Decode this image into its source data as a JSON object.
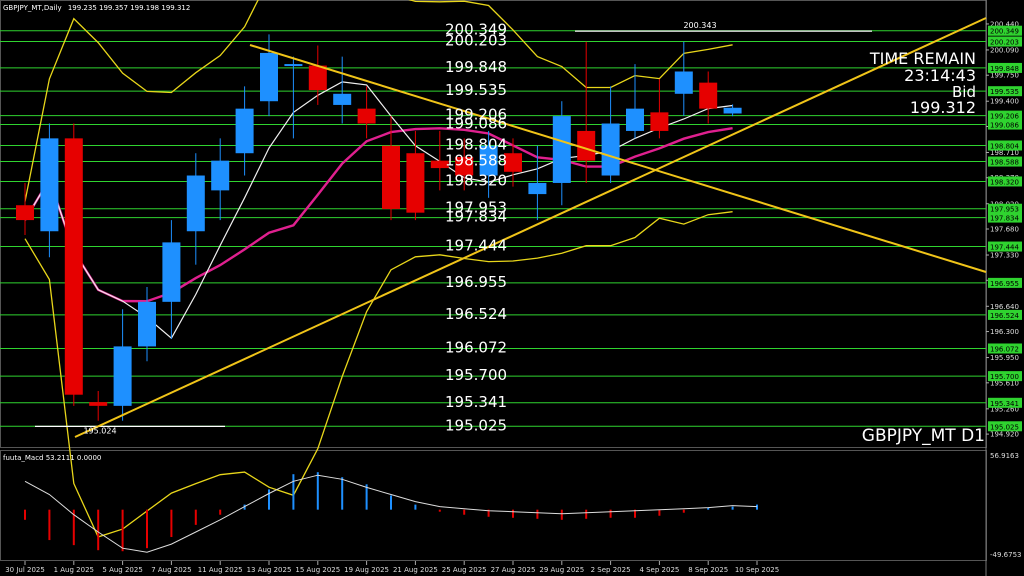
{
  "window": {
    "symbol_title": "GBPJPY_MT,Daily",
    "ohlc_header": "199.235 199.357 199.198 199.312",
    "corner_label": "GBPJPY_MT D1"
  },
  "info": {
    "time_remain_label": "TIME REMAIN",
    "time_remain_value": "23:14:43",
    "bid_label": "Bid",
    "bid_value": "199.312"
  },
  "levels": [
    {
      "price": 200.349,
      "label": "200.349",
      "axis_label": "200.349"
    },
    {
      "price": 200.203,
      "label": "200.203",
      "axis_label": "200.203"
    },
    {
      "price": 199.848,
      "label": "199.848",
      "axis_label": "199.848"
    },
    {
      "price": 199.535,
      "label": "199.535",
      "axis_label": "199.535"
    },
    {
      "price": 199.206,
      "label": "199.206",
      "axis_label": "199.206"
    },
    {
      "price": 199.086,
      "label": "199.086",
      "axis_label": "199.086"
    },
    {
      "price": 198.804,
      "label": "198.804",
      "axis_label": "198.804"
    },
    {
      "price": 198.588,
      "label": "198.588",
      "axis_label": "198.588"
    },
    {
      "price": 198.32,
      "label": "198.320",
      "axis_label": "198.320"
    },
    {
      "price": 197.953,
      "label": "197.953",
      "axis_label": "197.953"
    },
    {
      "price": 197.834,
      "label": "197.834",
      "axis_label": "197.834"
    },
    {
      "price": 197.444,
      "label": "197.444",
      "axis_label": "197.444"
    },
    {
      "price": 196.955,
      "label": "196.955",
      "axis_label": "196.955"
    },
    {
      "price": 196.524,
      "label": "196.524",
      "axis_label": "196.524"
    },
    {
      "price": 196.072,
      "label": "196.072",
      "axis_label": "196.072"
    },
    {
      "price": 195.7,
      "label": "195.700",
      "axis_label": "195.700"
    },
    {
      "price": 195.341,
      "label": "195.341",
      "axis_label": "195.341"
    },
    {
      "price": 195.025,
      "label": "195.025",
      "axis_label": "195.025"
    }
  ],
  "marks": {
    "high_line": {
      "price": 200.343,
      "label": "200.343"
    },
    "low_line": {
      "price": 195.024,
      "label": "195.024"
    }
  },
  "chart_data": {
    "type": "candlestick",
    "symbol": "GBPJPY_MT",
    "timeframe": "D1",
    "price_axis_ticks": [
      200.44,
      200.09,
      199.75,
      199.4,
      199.06,
      198.71,
      198.37,
      198.02,
      197.68,
      197.33,
      196.99,
      196.64,
      196.3,
      195.95,
      195.61,
      195.26,
      194.92
    ],
    "price_range": [
      194.8,
      200.52
    ],
    "date_labels": [
      {
        "bar": 0,
        "text": "30 Jul 2025"
      },
      {
        "bar": 2,
        "text": "1 Aug 2025"
      },
      {
        "bar": 4,
        "text": "5 Aug 2025"
      },
      {
        "bar": 6,
        "text": "7 Aug 2025"
      },
      {
        "bar": 8,
        "text": "11 Aug 2025"
      },
      {
        "bar": 10,
        "text": "13 Aug 2025"
      },
      {
        "bar": 12,
        "text": "15 Aug 2025"
      },
      {
        "bar": 14,
        "text": "19 Aug 2025"
      },
      {
        "bar": 16,
        "text": "21 Aug 2025"
      },
      {
        "bar": 18,
        "text": "25 Aug 2025"
      },
      {
        "bar": 20,
        "text": "27 Aug 2025"
      },
      {
        "bar": 22,
        "text": "29 Aug 2025"
      },
      {
        "bar": 24,
        "text": "2 Sep 2025"
      },
      {
        "bar": 26,
        "text": "4 Sep 2025"
      },
      {
        "bar": 28,
        "text": "8 Sep 2025"
      },
      {
        "bar": 30,
        "text": "10 Sep 2025"
      }
    ],
    "candles": [
      {
        "o": 198.0,
        "h": 198.3,
        "l": 197.6,
        "c": 197.8
      },
      {
        "o": 197.65,
        "h": 199.1,
        "l": 197.3,
        "c": 198.9
      },
      {
        "o": 198.9,
        "h": 199.1,
        "l": 195.3,
        "c": 195.45
      },
      {
        "o": 195.35,
        "h": 195.5,
        "l": 195.1,
        "c": 195.3
      },
      {
        "o": 195.3,
        "h": 196.6,
        "l": 195.1,
        "c": 196.1
      },
      {
        "o": 196.1,
        "h": 196.9,
        "l": 195.9,
        "c": 196.7
      },
      {
        "o": 196.7,
        "h": 197.8,
        "l": 196.2,
        "c": 197.5
      },
      {
        "o": 197.65,
        "h": 198.7,
        "l": 197.2,
        "c": 198.4
      },
      {
        "o": 198.2,
        "h": 198.9,
        "l": 197.8,
        "c": 198.6
      },
      {
        "o": 198.7,
        "h": 199.6,
        "l": 198.4,
        "c": 199.3
      },
      {
        "o": 199.4,
        "h": 200.3,
        "l": 199.2,
        "c": 200.05
      },
      {
        "o": 199.9,
        "h": 200.0,
        "l": 198.9,
        "c": 199.9
      },
      {
        "o": 199.88,
        "h": 200.15,
        "l": 199.35,
        "c": 199.55
      },
      {
        "o": 199.35,
        "h": 200.0,
        "l": 199.1,
        "c": 199.5
      },
      {
        "o": 199.3,
        "h": 199.6,
        "l": 198.9,
        "c": 199.1
      },
      {
        "o": 198.8,
        "h": 199.2,
        "l": 197.8,
        "c": 197.95
      },
      {
        "o": 198.7,
        "h": 199.0,
        "l": 197.8,
        "c": 197.9
      },
      {
        "o": 198.6,
        "h": 199.0,
        "l": 198.2,
        "c": 198.5
      },
      {
        "o": 198.65,
        "h": 198.9,
        "l": 198.2,
        "c": 198.4
      },
      {
        "o": 198.4,
        "h": 199.0,
        "l": 198.1,
        "c": 198.8
      },
      {
        "o": 198.7,
        "h": 198.9,
        "l": 198.25,
        "c": 198.45
      },
      {
        "o": 198.15,
        "h": 198.8,
        "l": 197.8,
        "c": 198.3
      },
      {
        "o": 198.3,
        "h": 199.4,
        "l": 198.0,
        "c": 199.2
      },
      {
        "o": 199.0,
        "h": 200.2,
        "l": 198.3,
        "c": 198.6
      },
      {
        "o": 198.4,
        "h": 199.6,
        "l": 198.3,
        "c": 199.1
      },
      {
        "o": 199.0,
        "h": 199.9,
        "l": 198.9,
        "c": 199.3
      },
      {
        "o": 199.25,
        "h": 199.7,
        "l": 198.9,
        "c": 199.0
      },
      {
        "o": 199.5,
        "h": 200.2,
        "l": 199.2,
        "c": 199.8
      },
      {
        "o": 199.65,
        "h": 199.8,
        "l": 199.1,
        "c": 199.3
      },
      {
        "o": 199.235,
        "h": 199.357,
        "l": 199.198,
        "c": 199.312
      }
    ],
    "indicator": {
      "name": "fuuta_Macd",
      "header": "fuuta_Macd 53.2111  0.0000",
      "axis_max_label": "56.9163",
      "axis_min_label": "-49.6753",
      "range": [
        -49.6753,
        56.9163
      ],
      "histogram": [
        -10,
        -30,
        -35,
        -40,
        -41,
        -38,
        -27,
        -15,
        -5,
        5,
        20,
        35,
        37,
        32,
        25,
        14,
        5,
        -2,
        -5,
        -7,
        -8,
        -9,
        -10,
        -9,
        -8,
        -8,
        -6,
        -3,
        2,
        3,
        5
      ],
      "signal": [
        28,
        15,
        -5,
        -22,
        -38,
        -42,
        -34,
        -22,
        -10,
        3,
        16,
        28,
        34,
        30,
        22,
        15,
        8,
        3,
        1,
        -1,
        -2,
        -3,
        -4,
        -3,
        -2,
        -1,
        0,
        1,
        2,
        4,
        3
      ]
    }
  },
  "colors": {
    "background": "#000000",
    "bull_candle": "#1e90ff",
    "bear_candle": "#e60000",
    "level_line": "#2fd32f",
    "trendline": "#f0c419",
    "bands": "#e8d61a",
    "ma_pink": "#e0208f",
    "ma_white": "#f0f0f0",
    "text": "#ffffff"
  }
}
